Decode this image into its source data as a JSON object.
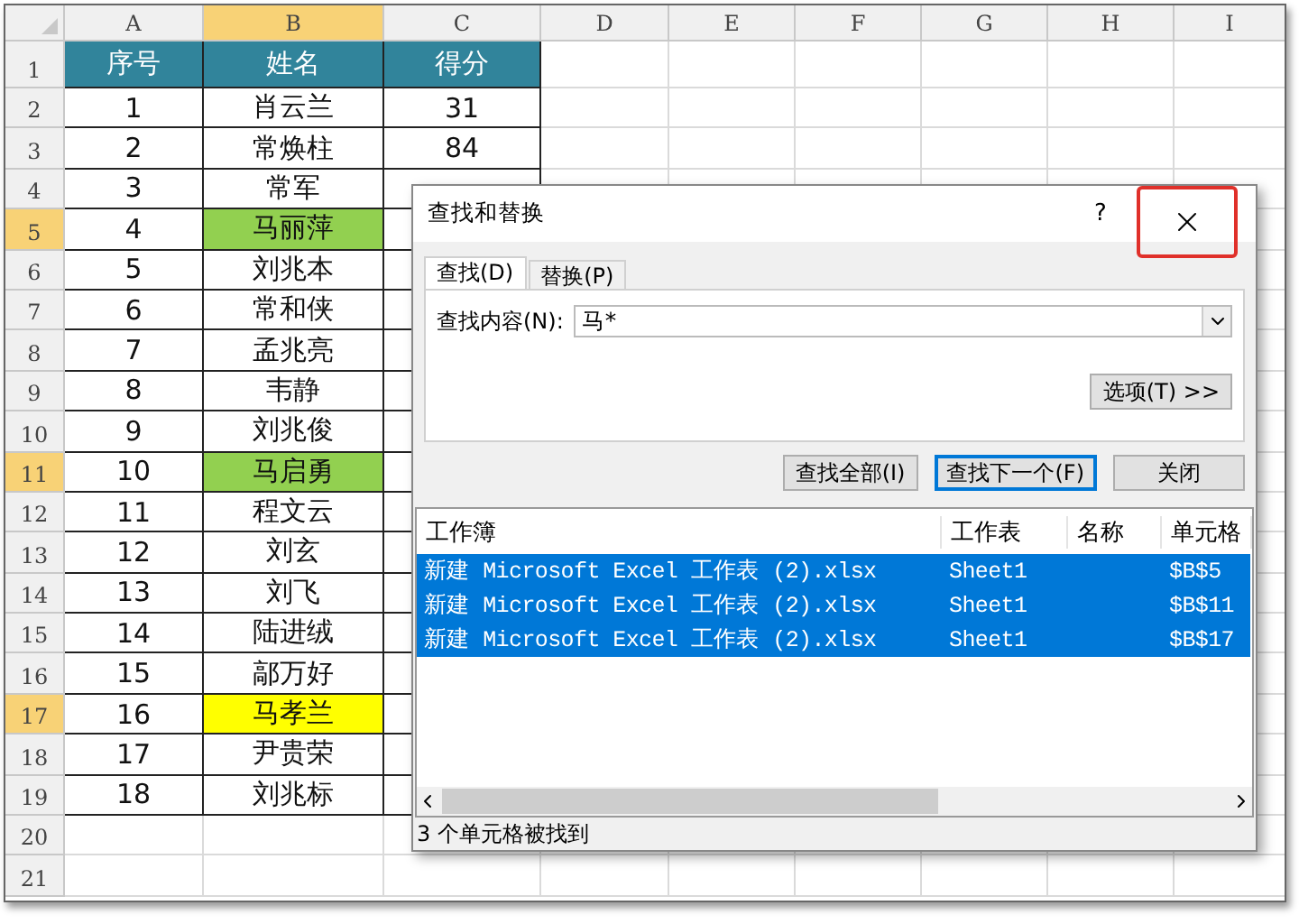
{
  "sheet": {
    "columns": [
      {
        "label": "A",
        "selected": false
      },
      {
        "label": "B",
        "selected": true
      },
      {
        "label": "C",
        "selected": false
      },
      {
        "label": "D",
        "selected": false
      },
      {
        "label": "E",
        "selected": false
      },
      {
        "label": "F",
        "selected": false
      },
      {
        "label": "G",
        "selected": false
      },
      {
        "label": "H",
        "selected": false
      },
      {
        "label": "I",
        "selected": false
      }
    ],
    "rows": [
      {
        "label": "1",
        "selected": false,
        "kind": "header",
        "cells": [
          {
            "text": "序号"
          },
          {
            "text": "姓名"
          },
          {
            "text": "得分"
          }
        ]
      },
      {
        "label": "2",
        "selected": false,
        "kind": "data",
        "cells": [
          {
            "text": "1"
          },
          {
            "text": "肖云兰"
          },
          {
            "text": "31"
          }
        ]
      },
      {
        "label": "3",
        "selected": false,
        "kind": "data",
        "cells": [
          {
            "text": "2"
          },
          {
            "text": "常焕柱"
          },
          {
            "text": "84"
          }
        ]
      },
      {
        "label": "4",
        "selected": false,
        "kind": "data",
        "cells": [
          {
            "text": "3"
          },
          {
            "text": "常军"
          }
        ]
      },
      {
        "label": "5",
        "selected": true,
        "kind": "data",
        "cells": [
          {
            "text": "4"
          },
          {
            "text": "马丽萍",
            "color": "#92d050"
          }
        ]
      },
      {
        "label": "6",
        "selected": false,
        "kind": "data",
        "cells": [
          {
            "text": "5"
          },
          {
            "text": "刘兆本"
          }
        ]
      },
      {
        "label": "7",
        "selected": false,
        "kind": "data",
        "cells": [
          {
            "text": "6"
          },
          {
            "text": "常和侠"
          }
        ]
      },
      {
        "label": "8",
        "selected": false,
        "kind": "data",
        "cells": [
          {
            "text": "7"
          },
          {
            "text": "孟兆亮"
          }
        ]
      },
      {
        "label": "9",
        "selected": false,
        "kind": "data",
        "cells": [
          {
            "text": "8"
          },
          {
            "text": "韦静"
          }
        ]
      },
      {
        "label": "10",
        "selected": false,
        "kind": "data",
        "cells": [
          {
            "text": "9"
          },
          {
            "text": "刘兆俊"
          }
        ]
      },
      {
        "label": "11",
        "selected": true,
        "kind": "data",
        "cells": [
          {
            "text": "10"
          },
          {
            "text": "马启勇",
            "color": "#92d050"
          }
        ]
      },
      {
        "label": "12",
        "selected": false,
        "kind": "data",
        "cells": [
          {
            "text": "11"
          },
          {
            "text": "程文云"
          }
        ]
      },
      {
        "label": "13",
        "selected": false,
        "kind": "data",
        "cells": [
          {
            "text": "12"
          },
          {
            "text": "刘玄"
          }
        ]
      },
      {
        "label": "14",
        "selected": false,
        "kind": "data",
        "cells": [
          {
            "text": "13"
          },
          {
            "text": "刘飞"
          }
        ]
      },
      {
        "label": "15",
        "selected": false,
        "kind": "data",
        "cells": [
          {
            "text": "14"
          },
          {
            "text": "陆进绒"
          }
        ]
      },
      {
        "label": "16",
        "selected": false,
        "kind": "data",
        "cells": [
          {
            "text": "15"
          },
          {
            "text": "鄗万好"
          }
        ]
      },
      {
        "label": "17",
        "selected": true,
        "kind": "data",
        "cells": [
          {
            "text": "16"
          },
          {
            "text": "马孝兰",
            "color": "#ffff00"
          }
        ]
      },
      {
        "label": "18",
        "selected": false,
        "kind": "data",
        "cells": [
          {
            "text": "17"
          },
          {
            "text": "尹贵荣"
          }
        ]
      },
      {
        "label": "19",
        "selected": false,
        "kind": "data",
        "cells": [
          {
            "text": "18"
          },
          {
            "text": "刘兆标"
          }
        ]
      },
      {
        "label": "20",
        "selected": false,
        "kind": "empty",
        "cells": []
      },
      {
        "label": "21",
        "selected": false,
        "kind": "empty",
        "cells": []
      }
    ]
  },
  "dialog": {
    "title": "查找和替换",
    "help": "?",
    "close_button": {
      "highlighted": true
    },
    "tabs": [
      {
        "label": "查找(D)",
        "selected": true
      },
      {
        "label": "替换(P)",
        "selected": false
      }
    ],
    "find_label": "查找内容(N):",
    "find_value": "马*",
    "options_button": "选项(T) >>",
    "buttons": [
      {
        "label": "查找全部(I)",
        "focused": false
      },
      {
        "label": "查找下一个(F)",
        "focused": true
      },
      {
        "label": "关闭",
        "focused": false
      }
    ],
    "results": {
      "columns": [
        "工作簿",
        "工作表",
        "名称",
        "单元格"
      ],
      "rows": [
        {
          "workbook": "新建 Microsoft Excel 工作表 (2).xlsx",
          "sheet": "Sheet1",
          "cell": "$B$5",
          "selected": true
        },
        {
          "workbook": "新建 Microsoft Excel 工作表 (2).xlsx",
          "sheet": "Sheet1",
          "cell": "$B$11",
          "selected": true
        },
        {
          "workbook": "新建 Microsoft Excel 工作表 (2).xlsx",
          "sheet": "Sheet1",
          "cell": "$B$17",
          "selected": true
        }
      ]
    },
    "status": "3 个单元格被找到"
  }
}
